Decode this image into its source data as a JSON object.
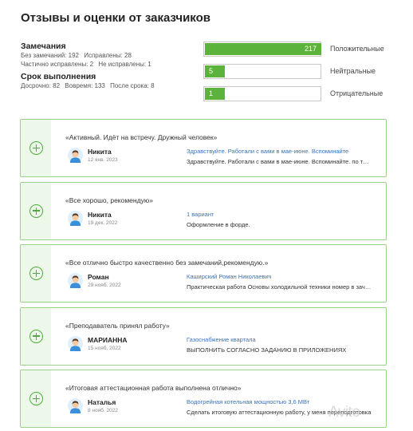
{
  "title": "Отзывы и оценки от заказчиков",
  "remarks": {
    "heading": "Замечания",
    "none": "Без замечаний: 192",
    "fixed": "Исправлены: 28",
    "partial": "Частично исправлены: 2",
    "not_fixed": "Не исправлены: 1"
  },
  "deadline": {
    "heading": "Срок выполнения",
    "early": "Досрочно: 82",
    "on_time": "Вовремя: 133",
    "late": "После срока: 8"
  },
  "ratings": [
    {
      "value": "217",
      "label": "Положительные",
      "fill_fraction": 1.0
    },
    {
      "value": "5",
      "label": "Нейтральные",
      "fill_fraction": 0.17
    },
    {
      "value": "1",
      "label": "Отрицательные",
      "fill_fraction": 0.17
    }
  ],
  "reviews": [
    {
      "quote": "«Активный. Идёт на встречу. Дружный человек»",
      "name": "Никита",
      "date": "12 янв. 2023",
      "subject": "Здравствуйте. Работали с вами в мае-июне. Вспоминайте",
      "excerpt": "Здравствуйте. Работали с вами в мае-июне. Вспоминайте. по тем…"
    },
    {
      "quote": "«Все хорошо, рекомендую»",
      "name": "Никита",
      "date": "19 дек. 2022",
      "subject": "1 вариант",
      "excerpt": "Оформление в форде."
    },
    {
      "quote": "«Все отлично быстро качественно без замечаний,рекомендую.»",
      "name": "Роман",
      "date": "29 нояб. 2022",
      "subject": "Каширский Роман Николаевич",
      "excerpt": "Практическая работа Основы холодильной техники номер в зачет…"
    },
    {
      "quote": "«Преподаватель принял работу»",
      "name": "МАРИАННА",
      "date": "15 нояб. 2022",
      "subject": "Газоснабжение квартала",
      "excerpt": "ВЫПОЛНИТЬ СОГЛАСНО ЗАДАНИЮ В ПРИЛОЖЕНИЯХ"
    },
    {
      "quote": "«Итоговая аттестационная работа выполнена отлично»",
      "name": "Наталья",
      "date": "8 нояб. 2022",
      "subject": "Водогрейная котельная мощностью 3,6 МВт",
      "excerpt": "Сделать итоговую аттестационную работу, у меня переподготовка"
    }
  ],
  "watermark": "Avito",
  "colors": {
    "accent_green": "#5bb33b",
    "card_border": "#9bd18a",
    "link_blue": "#3a73b8"
  },
  "icons": {
    "expand": "plus-circle-icon",
    "avatar": "user-avatar-icon"
  }
}
